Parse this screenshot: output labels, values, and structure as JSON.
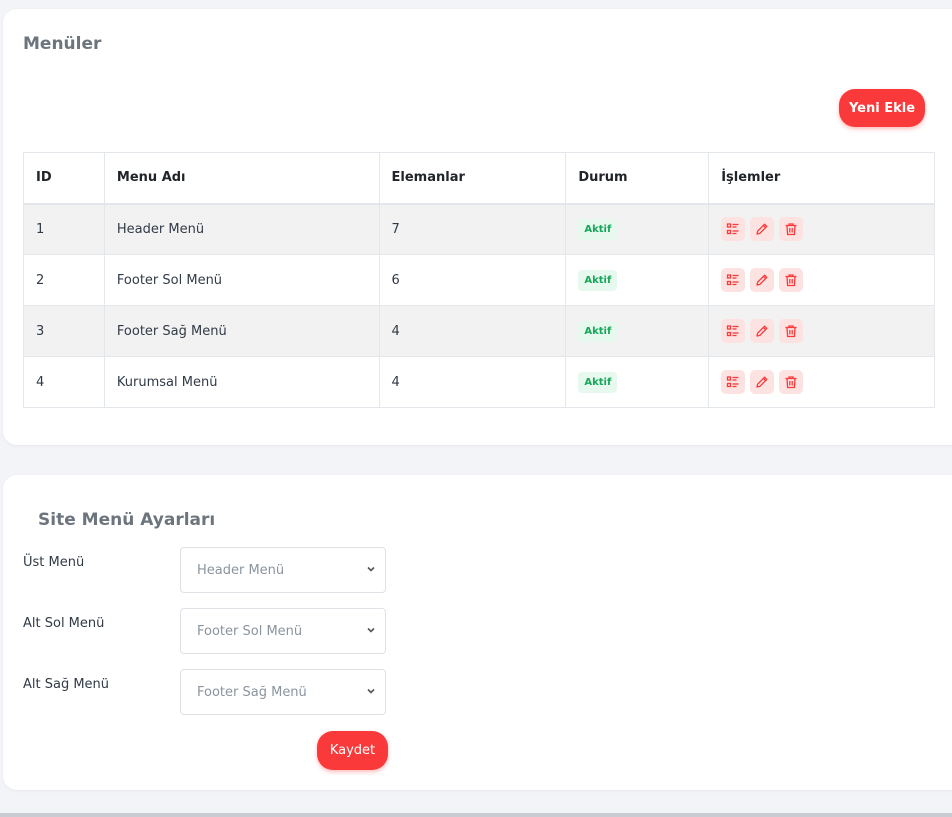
{
  "menus_card": {
    "title": "Menüler",
    "new_button": "Yeni Ekle",
    "columns": [
      "ID",
      "Menu Adı",
      "Elemanlar",
      "Durum",
      "İşlemler"
    ],
    "rows": [
      {
        "id": "1",
        "name": "Header Menü",
        "items": "7",
        "status": "Aktif"
      },
      {
        "id": "2",
        "name": "Footer Sol Menü",
        "items": "6",
        "status": "Aktif"
      },
      {
        "id": "3",
        "name": "Footer Sağ Menü",
        "items": "4",
        "status": "Aktif"
      },
      {
        "id": "4",
        "name": "Kurumsal Menü",
        "items": "4",
        "status": "Aktif"
      }
    ],
    "row_actions": [
      "list-icon",
      "edit-icon",
      "trash-icon"
    ]
  },
  "settings_card": {
    "title": "Site Menü Ayarları",
    "fields": [
      {
        "label": "Üst Menü",
        "value": "Header Menü"
      },
      {
        "label": "Alt Sol Menü",
        "value": "Footer Sol Menü"
      },
      {
        "label": "Alt Sağ Menü",
        "value": "Footer Sağ Menü"
      }
    ],
    "save_button": "Kaydet"
  },
  "colors": {
    "accent": "#fa3a3a",
    "badge_text": "#17a65a",
    "badge_bg": "#e7f8ee",
    "action_bg": "#fde2e2"
  }
}
